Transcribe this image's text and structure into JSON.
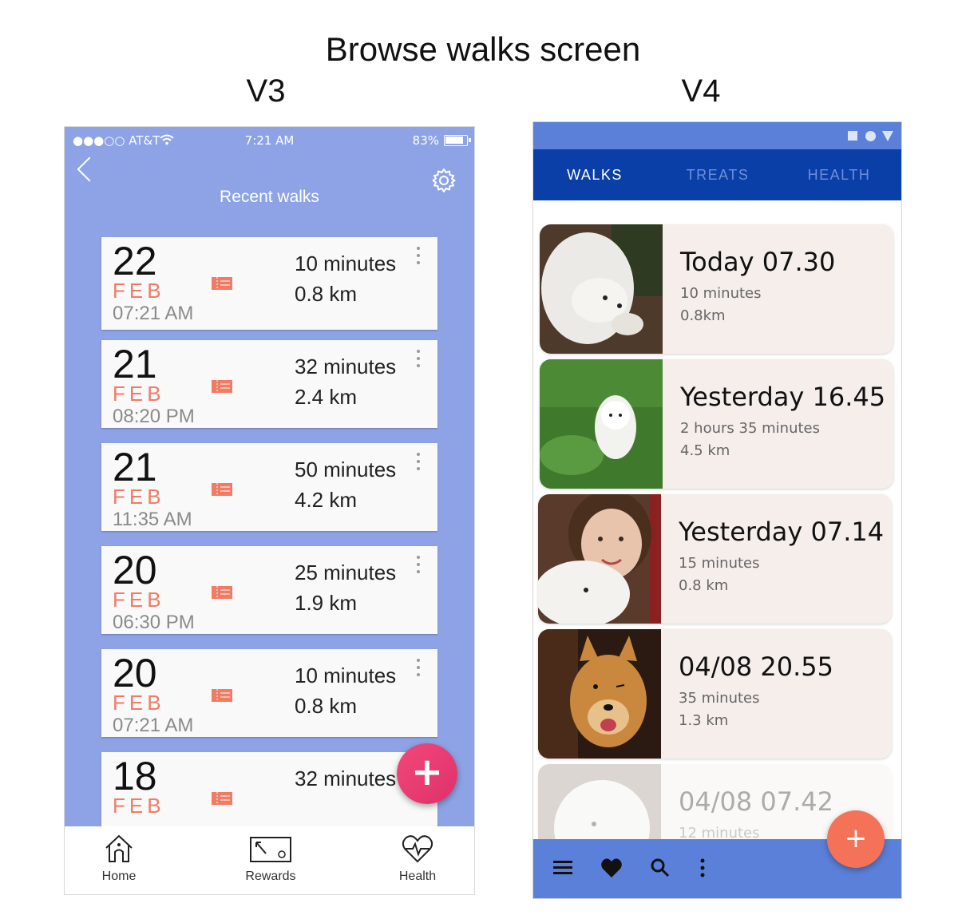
{
  "heading": "Browse walks screen",
  "labels": {
    "left": "V3",
    "right": "V4"
  },
  "v3": {
    "status": {
      "carrier": "●●●○○ AT&T",
      "time": "7:21 AM",
      "battery": "83%"
    },
    "title": "Recent walks",
    "walks": [
      {
        "day": "22",
        "month": "FEB",
        "time": "07:21 AM",
        "minutes": "10 minutes",
        "distance": "0.8 km"
      },
      {
        "day": "21",
        "month": "FEB",
        "time": "08:20 PM",
        "minutes": "32 minutes",
        "distance": "2.4 km"
      },
      {
        "day": "21",
        "month": "FEB",
        "time": "11:35 AM",
        "minutes": "50 minutes",
        "distance": "4.2 km"
      },
      {
        "day": "20",
        "month": "FEB",
        "time": "06:30 PM",
        "minutes": "25 minutes",
        "distance": "1.9 km"
      },
      {
        "day": "20",
        "month": "FEB",
        "time": "07:21 AM",
        "minutes": "10 minutes",
        "distance": "0.8 km"
      },
      {
        "day": "18",
        "month": "FEB",
        "time": "",
        "minutes": "32 minutes",
        "distance": ""
      }
    ],
    "fab": "+",
    "nav": [
      {
        "label": "Home",
        "icon": "home-icon"
      },
      {
        "label": "Rewards",
        "icon": "rewards-icon"
      },
      {
        "label": "Health",
        "icon": "heart-pulse-icon"
      }
    ]
  },
  "v4": {
    "tabs": [
      "WALKS",
      "TREATS",
      "HEALTH"
    ],
    "walks": [
      {
        "title": "Today 07.30",
        "minutes": "10 minutes",
        "distance": "0.8km",
        "photo": "white-dog-lying"
      },
      {
        "title": "Yesterday 16.45",
        "minutes": "2 hours 35 minutes",
        "distance": "4.5 km",
        "photo": "white-dog-grass"
      },
      {
        "title": "Yesterday 07.14",
        "minutes": "15 minutes",
        "distance": "0.8 km",
        "photo": "woman-with-dog"
      },
      {
        "title": "04/08 20.55",
        "minutes": "35 minutes",
        "distance": "1.3 km",
        "photo": "dog-winking"
      },
      {
        "title": "04/08 07.42",
        "minutes": "12 minutes",
        "distance": "",
        "photo": "white-dog-faded"
      }
    ],
    "fab": "+",
    "bottom_icons": [
      "menu-icon",
      "heart-icon",
      "search-icon",
      "more-vert-icon"
    ],
    "colors": {
      "tab_bar": "#0b3fa8",
      "status_bar": "#5b80d9",
      "card": "#f5eeeb",
      "fab": "#f47258"
    }
  }
}
